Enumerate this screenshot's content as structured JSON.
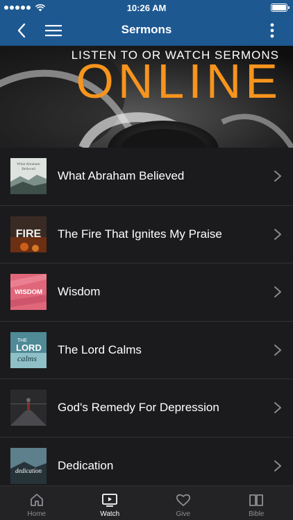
{
  "status_bar": {
    "time": "10:26 AM"
  },
  "nav": {
    "title": "Sermons"
  },
  "banner": {
    "line1": "LISTEN TO OR WATCH SERMONS",
    "line2": "ONLINE"
  },
  "sermons": [
    {
      "title": "What Abraham Believed",
      "thumb_text_1": "What Abraham",
      "thumb_text_2": "Believed"
    },
    {
      "title": "The Fire That Ignites My Praise",
      "thumb_text_1": "FIRE"
    },
    {
      "title": "Wisdom",
      "thumb_text_1": "WISDOM"
    },
    {
      "title": "The Lord Calms",
      "thumb_text_1": "THE",
      "thumb_text_2": "LORD",
      "thumb_text_3": "calms"
    },
    {
      "title": "God's Remedy For Depression"
    },
    {
      "title": "Dedication",
      "thumb_text_1": "dedication"
    }
  ],
  "tabs": [
    {
      "label": "Home",
      "icon": "home-icon"
    },
    {
      "label": "Watch",
      "icon": "watch-icon",
      "active": true
    },
    {
      "label": "Give",
      "icon": "heart-icon"
    },
    {
      "label": "Bible",
      "icon": "book-icon"
    }
  ]
}
